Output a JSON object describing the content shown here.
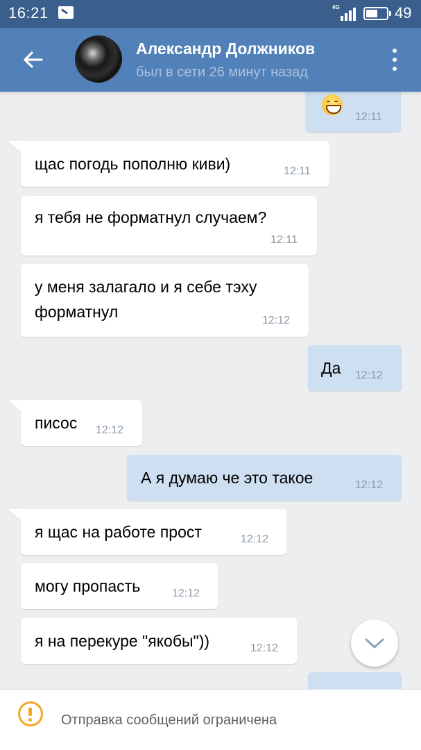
{
  "status_bar": {
    "time": "16:21",
    "network": "4G",
    "battery": "49"
  },
  "header": {
    "name": "Александр Должников",
    "subtitle": "был в сети 26 минут назад"
  },
  "messages": [
    {
      "direction": "out",
      "text": "",
      "emoji": "grinning-face",
      "time": "12:11"
    },
    {
      "direction": "in",
      "text": "щас погодь пополню киви)",
      "time": "12:11"
    },
    {
      "direction": "in",
      "text": "я тебя не форматнул случаем?",
      "time": "12:11"
    },
    {
      "direction": "in",
      "text_line1": "у меня залагало и я себе тэху",
      "text_line2": "форматнул",
      "time": "12:12"
    },
    {
      "direction": "out",
      "text": "Да",
      "time": "12:12"
    },
    {
      "direction": "in",
      "text": "писос",
      "time": "12:12"
    },
    {
      "direction": "out",
      "text": "А я думаю че это такое",
      "time": "12:12"
    },
    {
      "direction": "in",
      "text": "я щас на работе прост",
      "time": "12:12"
    },
    {
      "direction": "in",
      "text": "могу пропасть",
      "time": "12:12"
    },
    {
      "direction": "in",
      "text": "я на перекуре \"якобы\"))",
      "time": "12:12"
    }
  ],
  "bottom_bar": {
    "notice": "Отправка сообщений ограничена"
  },
  "colors": {
    "header": "#5181b8",
    "status_bar": "#3a5f8c",
    "outgoing_bubble": "#cfdff2",
    "warning": "#f5a623"
  },
  "icons": {
    "back": "arrow-left-icon",
    "menu": "more-vertical-icon",
    "scroll_down": "chevron-down-icon",
    "notice": "exclamation-circle-icon"
  }
}
